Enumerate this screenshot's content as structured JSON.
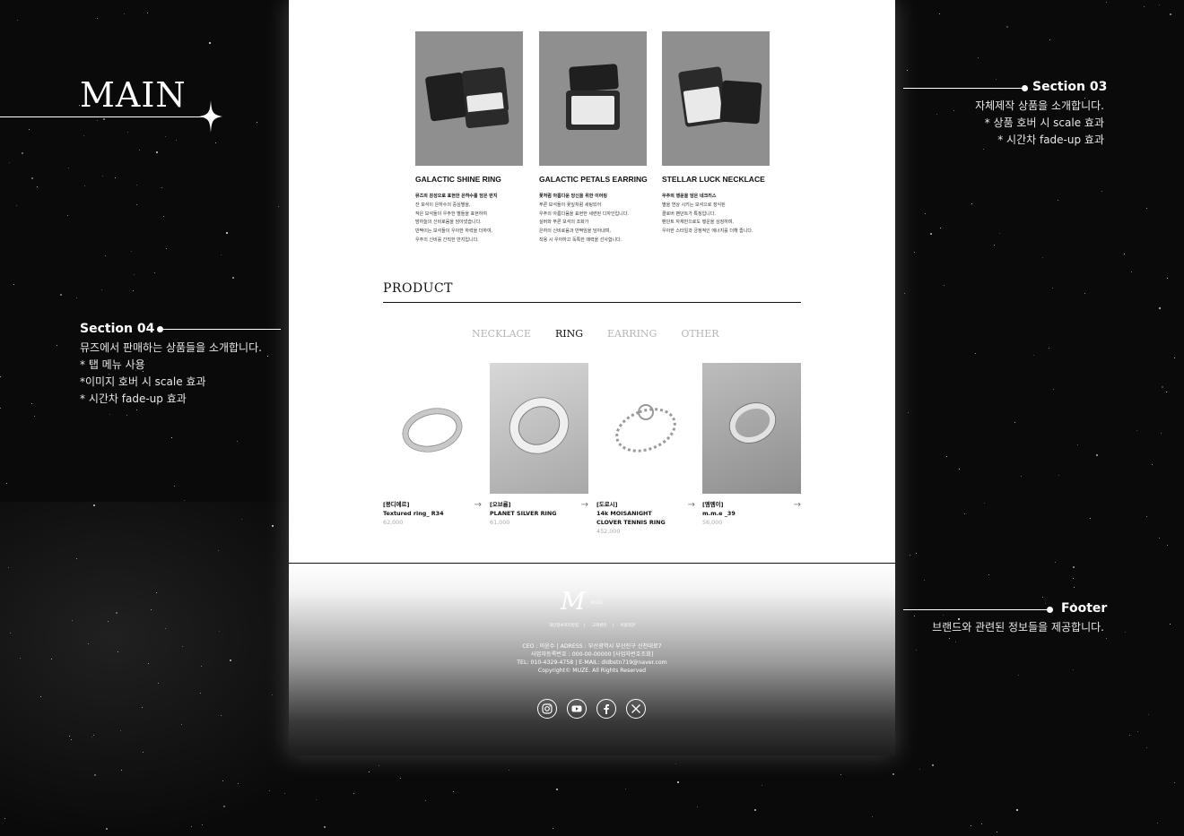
{
  "main_title": "MAIN",
  "section03": {
    "title": "Section 03",
    "lines": [
      "자체제작 상품을 소개합니다.",
      "* 상품 호버 시 scale 효과",
      "* 시간차 fade-up 효과"
    ]
  },
  "section04": {
    "title": "Section 04",
    "lines": [
      "뮤즈에서 판매하는 상품들을 소개합니다.",
      "* 탭 메뉴 사용",
      "*이미지 호버 시 scale 효과",
      "* 시간차 fade-up 효과"
    ]
  },
  "footer_note": {
    "title": "Footer",
    "lines": [
      "브랜드와 관련된 정보들을 제공합니다."
    ]
  },
  "featured": [
    {
      "name": "GALACTIC SHINE RING",
      "desc_title": "뮤즈의 감성으로 표현한 은하수를 담은 반지",
      "desc": [
        "잔 보석이 은하수의 중심별을,",
        "작은 보석들이 우주한 별들을 표현하여",
        "밤하늘의 신비로움을 담아냈습니다.",
        "반짝이는 보석들이 우아한 하력을 더하여,",
        "우주의 신비를 간직한 반지입니다."
      ]
    },
    {
      "name": "GALACTIC PETALS EARRING",
      "desc_title": "꽃처럼 아름다운 당신을 위한 이어링",
      "desc": [
        "푸른 보석들이 꽃잎처럼 세팅되어",
        "우주의 아름다움을 표현한 세련된 디자인입니다.",
        "실버와 푸른 보석의 조화가",
        "은하의 신비로움과 반짝임을 담아내며,",
        "착용 시 우아하고 독특한 매력을 선사합니다."
      ]
    },
    {
      "name": "STELLAR LUCK NECKLACE",
      "desc_title": "우주의 행운을 담은 네크리스",
      "desc": [
        "별을 연상 시키는 보석으로 장식된",
        "클로버 팬던트가 특징입니다.",
        "팬던트 자체만으로도 행운을 상징하며,",
        "우아한 스타일과 긍정적인 에너지를 더해 줍니다."
      ]
    }
  ],
  "product": {
    "title": "PRODUCT",
    "tabs": [
      {
        "label": "NECKLACE",
        "active": false
      },
      {
        "label": "RING",
        "active": true
      },
      {
        "label": "EARRING",
        "active": false
      },
      {
        "label": "OTHER",
        "active": false
      }
    ],
    "items": [
      {
        "brand": "[봉디에르]",
        "name": "Textured ring_ R34",
        "price": "62,000"
      },
      {
        "brand": "[오브륨]",
        "name": "PLANET SILVER RING",
        "price": "61,000"
      },
      {
        "brand": "[도로시]",
        "name": "14k MOISANIGHT CLOVER TENNIS RING",
        "price": "452,000"
      },
      {
        "brand": "[엠엠이]",
        "name": "m.m.e _39",
        "price": "56,000"
      }
    ],
    "arrow": "→"
  },
  "footer": {
    "logo": "M",
    "logo_sub": "MUZE",
    "links": [
      "개인정보처리방침",
      "고객센터",
      "이용약관"
    ],
    "info": [
      "CEO : 이윤수  |  ADRESS : 부산광역시 부산진구 신천대로7",
      "사업자등록번호 : 000-00-00000  [사업자번호조회]",
      "TEL: 010-4329-4758  |  E-MAIL: dldbstn719@naver.com",
      "Copyright© MUZE. All Rights Reserved"
    ],
    "socials": [
      "instagram-icon",
      "youtube-icon",
      "facebook-icon",
      "x-icon"
    ]
  },
  "colors": {
    "background": "#0a0a0a",
    "page": "#ffffff",
    "card_image": "#8f8f8f",
    "tab_inactive": "#b5b5b5",
    "price": "#aaaaaa"
  }
}
